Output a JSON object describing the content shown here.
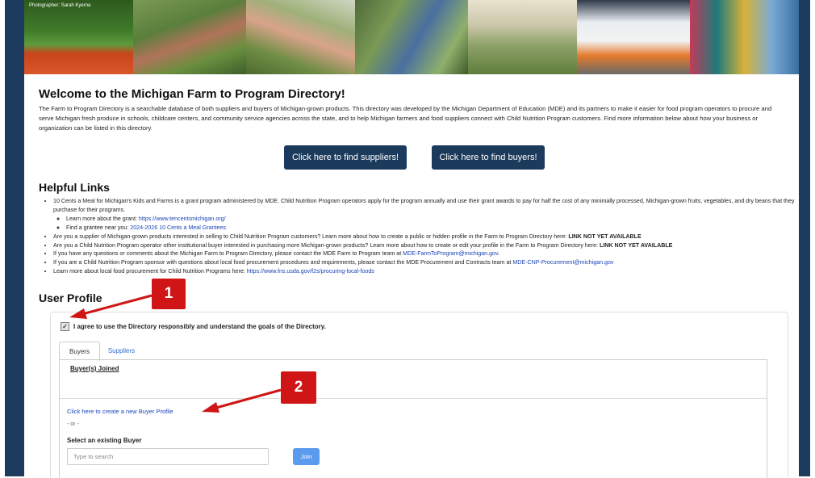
{
  "banner": {
    "photo_credit": "Photographer: Sarah Kyerna"
  },
  "welcome": {
    "title": "Welcome to the Michigan Farm to Program Directory!",
    "intro": "The Farm to Program Directory is a searchable database of both suppliers and buyers of Michigan-grown products. This directory was developed by the Michigan Department of Education (MDE) and its partners to make it easier for food program operators to procure and serve Michigan fresh produce in schools, childcare centers, and community service agencies across the state, and to help Michigan farmers and food suppliers connect with Child Nutrition Program customers. Find more information below about how your business or organization can be listed in this directory.",
    "find_suppliers_button": "Click here to find suppliers!",
    "find_buyers_button": "Click here to find buyers!"
  },
  "helpful_links": {
    "title": "Helpful Links",
    "item1": "10 Cents a Meal for Michigan's Kids and Farms is a grant program administered by MDE. Child Nutrition Program operators apply for the program annually and use their grant awards to pay for half the cost of any minimally processed, Michigan-grown fruits, vegetables, and dry beans that they purchase for their programs.",
    "item1_sub1_text": "Learn more about the grant: ",
    "item1_sub1_link": "https://www.tencentsmichigan.org/",
    "item1_sub2_text": "Find a grantee near you: ",
    "item1_sub2_link": "2024-2026 10 Cents a Meal Grantees",
    "item2_text": "Are you a supplier of Michigan-grown products interested in selling to Child Nutrition Program customers? Learn more about how to create a public or hidden profile in the Farm to Program Directory here: ",
    "item2_status": "LINK NOT YET AVAILABLE",
    "item3_text": "Are you a Child Nutrition Program operator other institutional buyer interested in purchasing more Michigan-grown products? Learn more about how to create or edit your profile in the Farm to Program Directory here: ",
    "item3_status": "LINK NOT YET AVAILABLE",
    "item4_text": "If you have any questions or comments about the Michigan Farm to Program Directory, please contact the MDE Farm to Program team at ",
    "item4_link": "MDE-FarmToProgram@michigan.gov",
    "item5_text": "If you are a Child Nutrition Program sponsor with questions about local food procurement procedures and requirements, please contact the MDE Procurement and Contracts team at ",
    "item5_link": "MDE-CNP-Procurement@michigan.gov",
    "item6_text": "Learn more about local food procurement for Child Nutrition Programs here: ",
    "item6_link": "https://www.fns.usda.gov/f2s/procuring-local-foods"
  },
  "user_profile": {
    "title": "User Profile",
    "agree_label": "I agree to use the Directory responsibly and understand the goals of the Directory.",
    "agree_checked": true,
    "tabs": [
      "Buyers",
      "Suppliers"
    ],
    "active_tab": "Buyers",
    "joined_heading": "Buyer(s) Joined",
    "create_link": "Click here to create a new Buyer Profile",
    "or_text": "- or -",
    "select_label": "Select an existing Buyer",
    "search_placeholder": "Type to search",
    "join_button": "Join"
  },
  "annotations": {
    "marker1": "1",
    "marker2": "2",
    "color": "#cf1515"
  },
  "colors": {
    "frame": "#1d3b5e",
    "button": "#1b3a5c",
    "link": "#1a44b8",
    "join": "#5b9bef"
  }
}
